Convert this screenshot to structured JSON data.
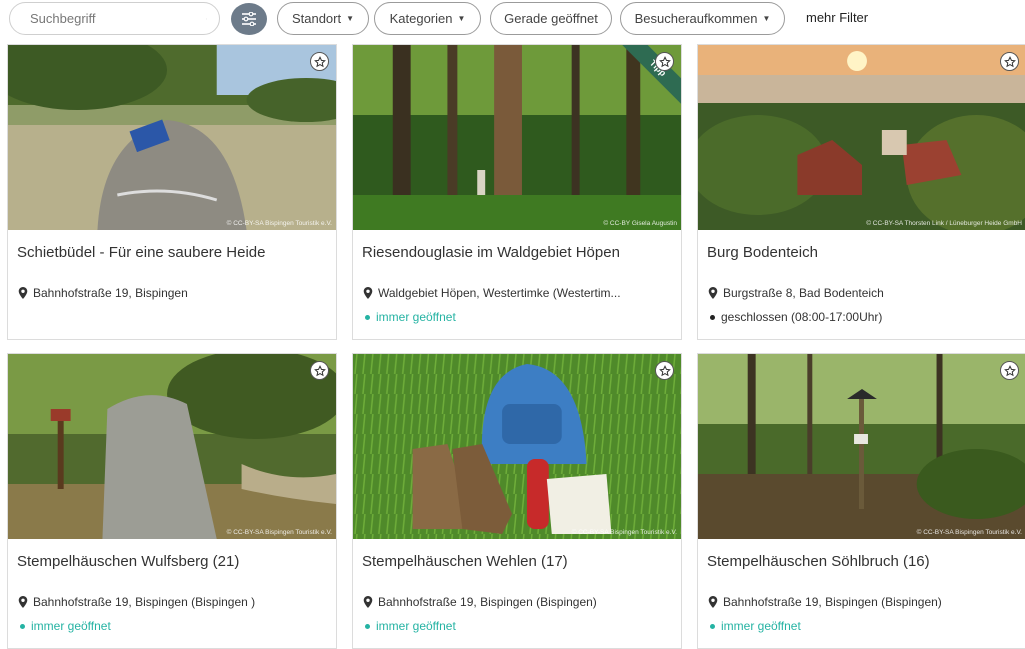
{
  "search": {
    "placeholder": "Suchbegriff",
    "value": ""
  },
  "filters": {
    "standort": "Standort",
    "kategorien": "Kategorien",
    "gerade_geoeffnet": "Gerade geöffnet",
    "besucheraufkommen": "Besucheraufkommen",
    "more": "mehr Filter"
  },
  "colors": {
    "accent_open": "#25b3a3",
    "toggle_bg": "#6d7b8a",
    "tip_ribbon": "#2e6b52"
  },
  "cards": [
    {
      "title": "Schietbüdel - Für eine saubere Heide",
      "address": "Bahnhofstraße 19, Bispingen",
      "status": "",
      "copyright": "© CC-BY-SA Bispingen Touristik e.V.",
      "image_icon": "stone-waymarker-photo"
    },
    {
      "title": "Riesendouglasie im Waldgebiet Höpen",
      "address": "Waldgebiet Höpen, Westertimke (Westertim...",
      "status": "immer geöffnet",
      "badge": "Tipp",
      "copyright": "© CC-BY Gisela Augustin",
      "image_icon": "forest-tree-photo"
    },
    {
      "title": "Burg Bodenteich",
      "address": "Burgstraße 8, Bad Bodenteich",
      "status": "geschlossen (08:00-17:00Uhr)",
      "copyright": "© CC-BY-SA Thorsten Link / Lüneburger Heide GmbH",
      "image_icon": "castle-aerial-photo"
    },
    {
      "title": "Stempelhäuschen Wulfsberg (21)",
      "address": "Bahnhofstraße 19, Bispingen (Bispingen )",
      "status": "immer geöffnet",
      "copyright": "© CC-BY-SA Bispingen Touristik e.V.",
      "image_icon": "stone-marker-photo"
    },
    {
      "title": "Stempelhäuschen Wehlen (17)",
      "address": "Bahnhofstraße 19, Bispingen (Bispingen)",
      "status": "immer geöffnet",
      "copyright": "© CC-BY-SA Bispingen Touristik e.V.",
      "image_icon": "hiking-gear-photo"
    },
    {
      "title": "Stempelhäuschen Söhlbruch (16)",
      "address": "Bahnhofstraße 19, Bispingen (Bispingen)",
      "status": "immer geöffnet",
      "copyright": "© CC-BY-SA Bispingen Touristik e.V.",
      "image_icon": "forest-stamp-post-photo"
    }
  ]
}
